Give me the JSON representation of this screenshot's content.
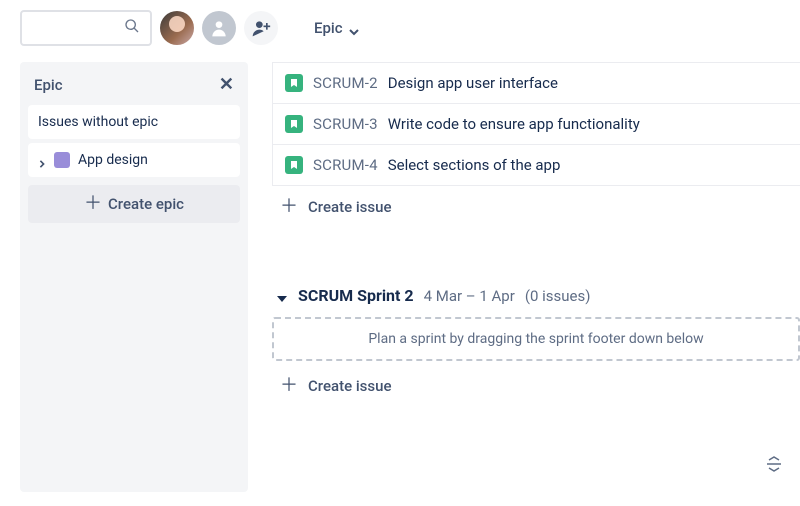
{
  "toolbar": {
    "search_placeholder": "",
    "epic_dropdown_label": "Epic"
  },
  "epic_panel": {
    "title": "Epic",
    "no_epic_label": "Issues without epic",
    "epics": [
      {
        "name": "App design",
        "color": "#998DD9"
      }
    ],
    "create_label": "Create epic"
  },
  "backlog": {
    "issues": [
      {
        "key": "SCRUM-2",
        "summary": "Design app user interface"
      },
      {
        "key": "SCRUM-3",
        "summary": "Write code to ensure app functionality"
      },
      {
        "key": "SCRUM-4",
        "summary": "Select sections of the app"
      }
    ],
    "create_issue_label": "Create issue"
  },
  "sprint": {
    "name": "SCRUM Sprint 2",
    "dates": "4 Mar – 1 Apr",
    "count_label": "(0 issues)",
    "dropzone_text": "Plan a sprint by dragging the sprint footer down below",
    "create_issue_label": "Create issue"
  }
}
